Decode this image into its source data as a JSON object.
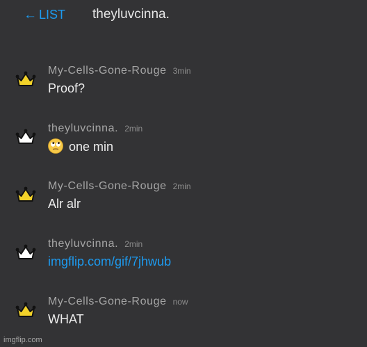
{
  "header": {
    "back_arrow": "←",
    "back_label": "LIST",
    "title": "theyluvcinna."
  },
  "messages": [
    {
      "username": "My-Cells-Gone-Rouge",
      "time": "3min",
      "text": "Proof?",
      "crown_color": "#f2d22a",
      "is_link": false
    },
    {
      "username": "theyluvcinna.",
      "time": "2min",
      "text": "one min",
      "emoji": "face-with-rolling-eyes",
      "crown_color": "#ffffff",
      "is_link": false
    },
    {
      "username": "My-Cells-Gone-Rouge",
      "time": "2min",
      "text": "Alr alr",
      "crown_color": "#f2d22a",
      "is_link": false
    },
    {
      "username": "theyluvcinna.",
      "time": "2min",
      "text": "imgflip.com/gif/7jhwub",
      "crown_color": "#ffffff",
      "is_link": true
    },
    {
      "username": "My-Cells-Gone-Rouge",
      "time": "now",
      "text": "WHAT",
      "crown_color": "#f2d22a",
      "is_link": false
    }
  ],
  "watermark": "imgflip.com",
  "colors": {
    "background": "#333335",
    "accent_link": "#1d9bf0",
    "username": "#a6a6a6",
    "message_text": "#ececec"
  }
}
